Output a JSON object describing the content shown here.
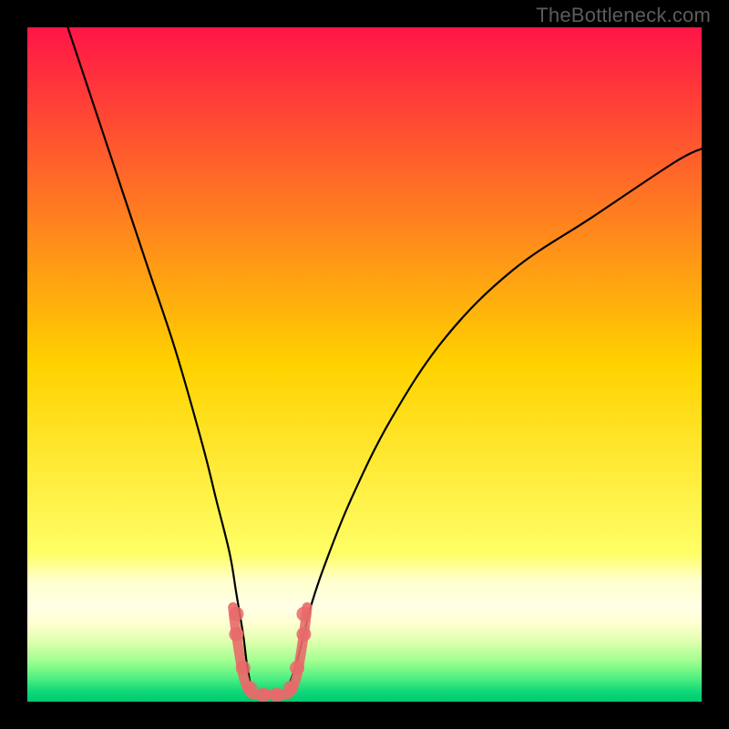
{
  "watermark": "TheBottleneck.com",
  "chart_data": {
    "type": "line",
    "title": "",
    "xlabel": "",
    "ylabel": "",
    "xlim": [
      0,
      100
    ],
    "ylim": [
      0,
      100
    ],
    "grid": false,
    "legend": false,
    "gradient_stops": [
      {
        "pos": 0.0,
        "color": "#ff1547"
      },
      {
        "pos": 0.5,
        "color": "#ffd200"
      },
      {
        "pos": 0.78,
        "color": "#ffff66"
      },
      {
        "pos": 0.82,
        "color": "#ffffcc"
      },
      {
        "pos": 0.86,
        "color": "#ffffe6"
      },
      {
        "pos": 0.885,
        "color": "#ffffd0"
      },
      {
        "pos": 0.91,
        "color": "#e0ffb0"
      },
      {
        "pos": 0.94,
        "color": "#a0ff90"
      },
      {
        "pos": 0.965,
        "color": "#50f080"
      },
      {
        "pos": 0.985,
        "color": "#10d878"
      },
      {
        "pos": 1.0,
        "color": "#00c870"
      }
    ],
    "series": [
      {
        "name": "bottleneck-curve-left",
        "color": "#000000",
        "x": [
          6,
          10,
          14,
          18,
          22,
          26,
          28,
          30,
          31,
          32,
          32.5,
          33
        ],
        "y": [
          100,
          88,
          76,
          64,
          52,
          38,
          30,
          22,
          16,
          10,
          6,
          3
        ]
      },
      {
        "name": "bottleneck-curve-right",
        "color": "#000000",
        "x": [
          39,
          40,
          41,
          42,
          44,
          48,
          54,
          62,
          72,
          84,
          96,
          100
        ],
        "y": [
          3,
          6,
          10,
          14,
          20,
          30,
          42,
          54,
          64,
          72,
          80,
          82
        ]
      },
      {
        "name": "bottleneck-floor",
        "color": "#e86a6a",
        "x": [
          30.5,
          31,
          32,
          33,
          34,
          35,
          36,
          37,
          38,
          39,
          40,
          41,
          41.5
        ],
        "y": [
          14,
          10,
          4,
          1.5,
          1,
          1,
          1,
          1,
          1,
          1.5,
          4,
          10,
          14
        ]
      }
    ],
    "markers": [
      {
        "x": 31,
        "y": 13,
        "color": "#e86a6a"
      },
      {
        "x": 31,
        "y": 10,
        "color": "#e86a6a"
      },
      {
        "x": 32,
        "y": 5,
        "color": "#e86a6a"
      },
      {
        "x": 33,
        "y": 2,
        "color": "#e86a6a"
      },
      {
        "x": 35,
        "y": 1,
        "color": "#e86a6a"
      },
      {
        "x": 37,
        "y": 1,
        "color": "#e86a6a"
      },
      {
        "x": 39,
        "y": 2,
        "color": "#e86a6a"
      },
      {
        "x": 40,
        "y": 5,
        "color": "#e86a6a"
      },
      {
        "x": 41,
        "y": 10,
        "color": "#e86a6a"
      },
      {
        "x": 41,
        "y": 13,
        "color": "#e86a6a"
      }
    ]
  }
}
